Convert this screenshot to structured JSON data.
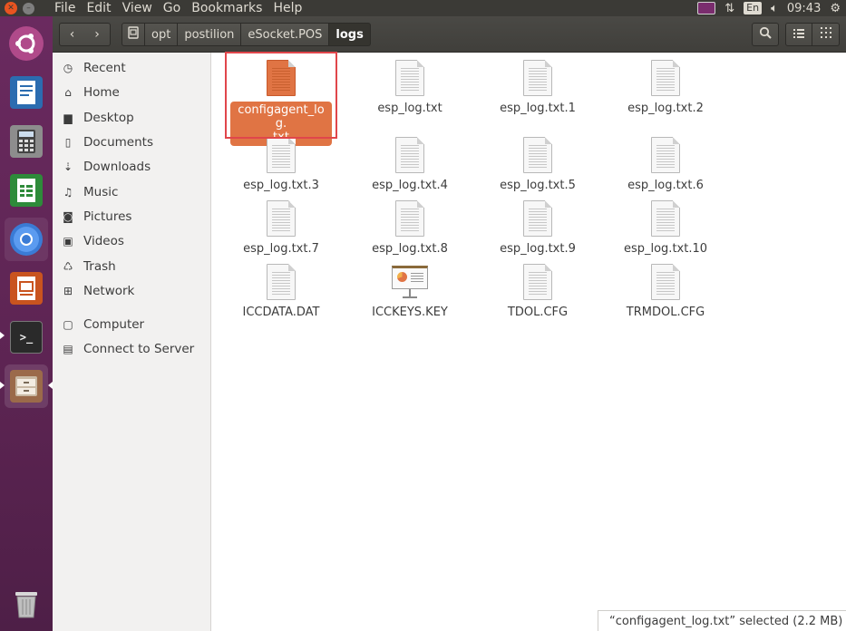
{
  "menubar": {
    "items": [
      "File",
      "Edit",
      "View",
      "Go",
      "Bookmarks",
      "Help"
    ],
    "language": "En",
    "clock": "09:43"
  },
  "launcher": {
    "apps": [
      "ubuntu-dash",
      "libreoffice-writer",
      "calculator",
      "libreoffice-calc",
      "chromium",
      "libreoffice-impress",
      "terminal",
      "files",
      "trash"
    ]
  },
  "pathbar": {
    "crumbs": [
      "opt",
      "postilion",
      "eSocket.POS",
      "logs"
    ]
  },
  "sidebar": {
    "places": [
      "Recent",
      "Home",
      "Desktop",
      "Documents",
      "Downloads",
      "Music",
      "Pictures",
      "Videos",
      "Trash",
      "Network"
    ],
    "devices": [
      "Computer",
      "Connect to Server"
    ]
  },
  "files": [
    {
      "name": "configagent_log.txt",
      "label_line1": "configagent_log.",
      "label_line2": "txt",
      "type": "text",
      "selected": true
    },
    {
      "name": "esp_log.txt",
      "type": "text"
    },
    {
      "name": "esp_log.txt.1",
      "type": "text"
    },
    {
      "name": "esp_log.txt.2",
      "type": "text"
    },
    {
      "name": "esp_log.txt.3",
      "type": "text"
    },
    {
      "name": "esp_log.txt.4",
      "type": "text"
    },
    {
      "name": "esp_log.txt.5",
      "type": "text"
    },
    {
      "name": "esp_log.txt.6",
      "type": "text"
    },
    {
      "name": "esp_log.txt.7",
      "type": "text"
    },
    {
      "name": "esp_log.txt.8",
      "type": "text"
    },
    {
      "name": "esp_log.txt.9",
      "type": "text"
    },
    {
      "name": "esp_log.txt.10",
      "type": "text"
    },
    {
      "name": "ICCDATA.DAT",
      "type": "text"
    },
    {
      "name": "ICCKEYS.KEY",
      "type": "presentation"
    },
    {
      "name": "TDOL.CFG",
      "type": "text"
    },
    {
      "name": "TRMDOL.CFG",
      "type": "text"
    }
  ],
  "status": {
    "text": "“configagent_log.txt” selected  (2.2 MB)"
  },
  "colors": {
    "accent": "#e07444",
    "launcher": "#5c2452",
    "highlight_box": "#e0464b"
  }
}
